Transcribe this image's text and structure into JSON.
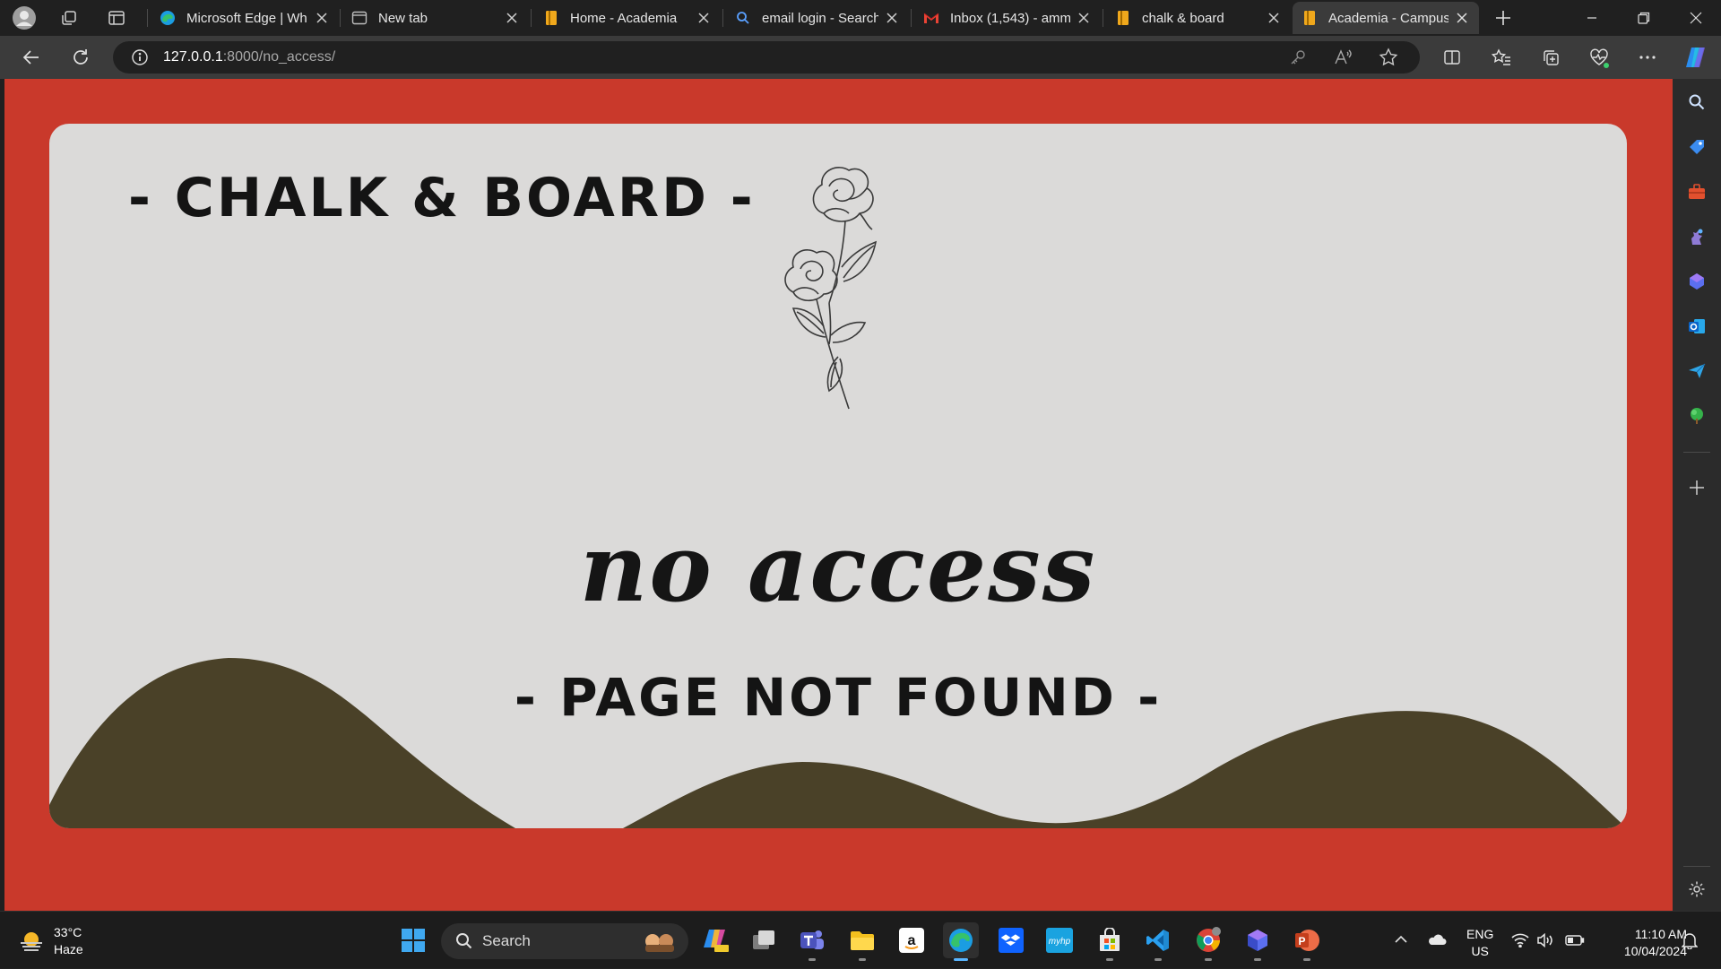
{
  "browser": {
    "tabs": [
      {
        "title": "Microsoft Edge | Wh",
        "favicon": "edge-icon"
      },
      {
        "title": "New tab",
        "favicon": "newtab-icon"
      },
      {
        "title": "Home - Academia",
        "favicon": "book-icon"
      },
      {
        "title": "email login - Search",
        "favicon": "search-icon"
      },
      {
        "title": "Inbox (1,543) - amm",
        "favicon": "gmail-icon"
      },
      {
        "title": "chalk & board",
        "favicon": "book-icon"
      },
      {
        "title": "Academia - Campus",
        "favicon": "book-icon",
        "active": true
      }
    ],
    "url_host": "127.0.0.1",
    "url_path": ":8000/no_access/"
  },
  "page": {
    "brand": "- CHALK & BOARD -",
    "headline": "no access",
    "subheadline": "- PAGE NOT FOUND -",
    "colors": {
      "frame": "#c9392b",
      "card": "#dbdad9",
      "hills": "#4a4128",
      "text": "#141414"
    }
  },
  "taskbar": {
    "weather_temp": "33°C",
    "weather_desc": "Haze",
    "search_label": "Search",
    "lang_line1": "ENG",
    "lang_line2": "US",
    "time": "11:10 AM",
    "date": "10/04/2024"
  }
}
